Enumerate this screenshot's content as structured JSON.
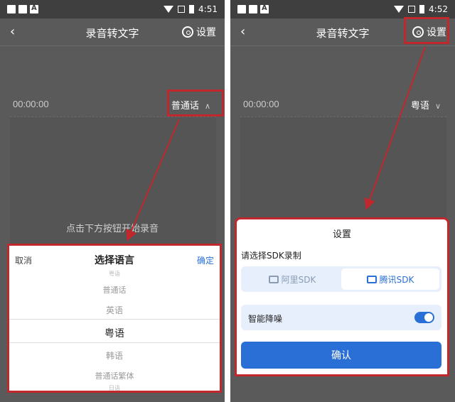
{
  "status": {
    "left_time": "4:51",
    "right_time": "4:52"
  },
  "left_screen": {
    "title": "录音转文字",
    "settings_label": "设置",
    "time": "00:00:00",
    "language": "普通话",
    "hint": "点击下方按钮开始录音",
    "picker": {
      "cancel": "取消",
      "title": "选择语言",
      "confirm": "确定",
      "options": [
        "粤语",
        "普通话",
        "英语",
        "粤语",
        "韩语",
        "普通话繁体",
        "日语"
      ],
      "selected": "粤语"
    }
  },
  "right_screen": {
    "title": "录音转文字",
    "settings_label": "设置",
    "time": "00:00:00",
    "language": "粤语",
    "sheet": {
      "title": "设置",
      "sdk_label": "请选择SDK录制",
      "sdk_options": [
        "阿里SDK",
        "腾讯SDK"
      ],
      "sdk_selected": "腾讯SDK",
      "noise_label": "智能降噪",
      "noise_on": true,
      "confirm": "确认"
    }
  },
  "colors": {
    "accent": "#2a6fd6",
    "highlight": "#c0282d"
  }
}
